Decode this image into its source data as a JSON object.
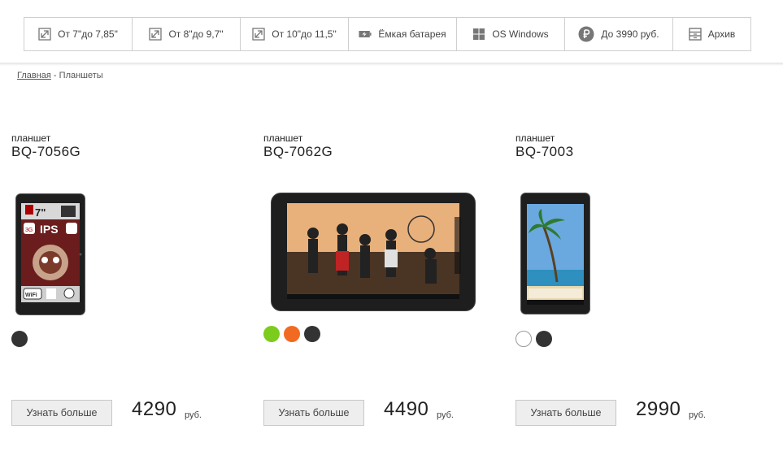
{
  "filters": [
    {
      "label": "От 7\"до 7,85\"",
      "icon": "resize-arrow-icon"
    },
    {
      "label": "От 8\"до 9,7\"",
      "icon": "resize-arrow-icon"
    },
    {
      "label": "От 10\"до 11,5\"",
      "icon": "resize-arrow-icon"
    },
    {
      "label": "Ёмкая батарея",
      "icon": "battery-icon"
    },
    {
      "label": "OS Windows",
      "icon": "windows-icon"
    },
    {
      "label": "До 3990 руб.",
      "icon": "ruble-icon"
    },
    {
      "label": "Архив",
      "icon": "archive-icon"
    }
  ],
  "breadcrumb": {
    "home": "Главная",
    "separator": " - ",
    "current": "Планшеты"
  },
  "products": [
    {
      "kind": "планшет",
      "model": "BQ-7056G",
      "button": "Узнать больше",
      "price": "4290",
      "currency": "руб.",
      "colors": [
        "#333333"
      ]
    },
    {
      "kind": "планшет",
      "model": "BQ-7062G",
      "button": "Узнать больше",
      "price": "4490",
      "currency": "руб.",
      "colors": [
        "#7ccc1e",
        "#f26a22",
        "#333333"
      ]
    },
    {
      "kind": "планшет",
      "model": "BQ-7003",
      "button": "Узнать больше",
      "price": "2990",
      "currency": "руб.",
      "colors": [
        "#ffffff",
        "#333333"
      ]
    }
  ],
  "tablet1_screen_text": {
    "size": "7\"",
    "display": "IPS",
    "net": "3G",
    "wifi": "WiFi"
  }
}
